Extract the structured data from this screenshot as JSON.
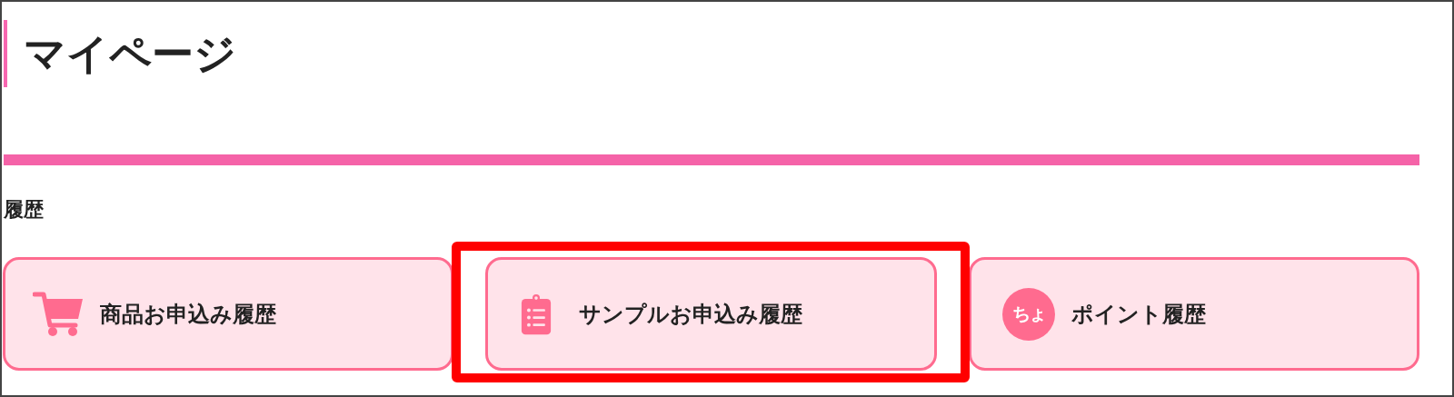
{
  "page_title": "マイページ",
  "section_label": "履歴",
  "history_links": [
    {
      "kind": "cart",
      "label": "商品お申込み履歴",
      "highlighted": false
    },
    {
      "kind": "clipboard",
      "label": "サンプルお申込み履歴",
      "highlighted": true
    },
    {
      "kind": "badge",
      "badge_text": "ちょ",
      "label": "ポイント履歴",
      "highlighted": false
    }
  ]
}
